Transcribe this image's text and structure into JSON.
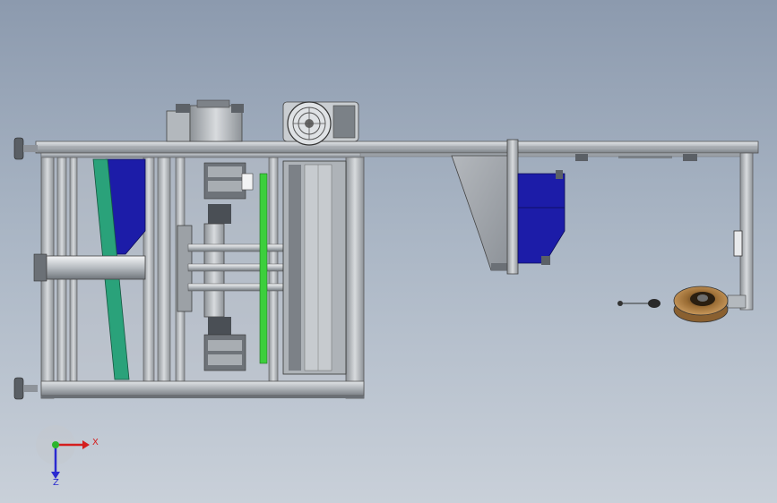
{
  "viewport": {
    "background_top": "#8c9aae",
    "background_bottom": "#c9d0d9",
    "frame_color": "#b9bec4",
    "blue_part_color": "#1c1ca8",
    "green_belt_color": "#2aa27a",
    "green_strip_color": "#3ccf3c"
  },
  "triad": {
    "x_label": "X",
    "z_label": "Z",
    "x_color": "#d41e1e",
    "y_color": "#2db52d",
    "z_color": "#2a2ad0"
  },
  "model": {
    "parts": [
      "left-frame",
      "top-rail",
      "arm-extension",
      "motor-fan",
      "gear-motor",
      "hopper-chute",
      "blue-hopper",
      "rollers",
      "green-belt",
      "pulley-assembly",
      "leveling-feet"
    ]
  }
}
